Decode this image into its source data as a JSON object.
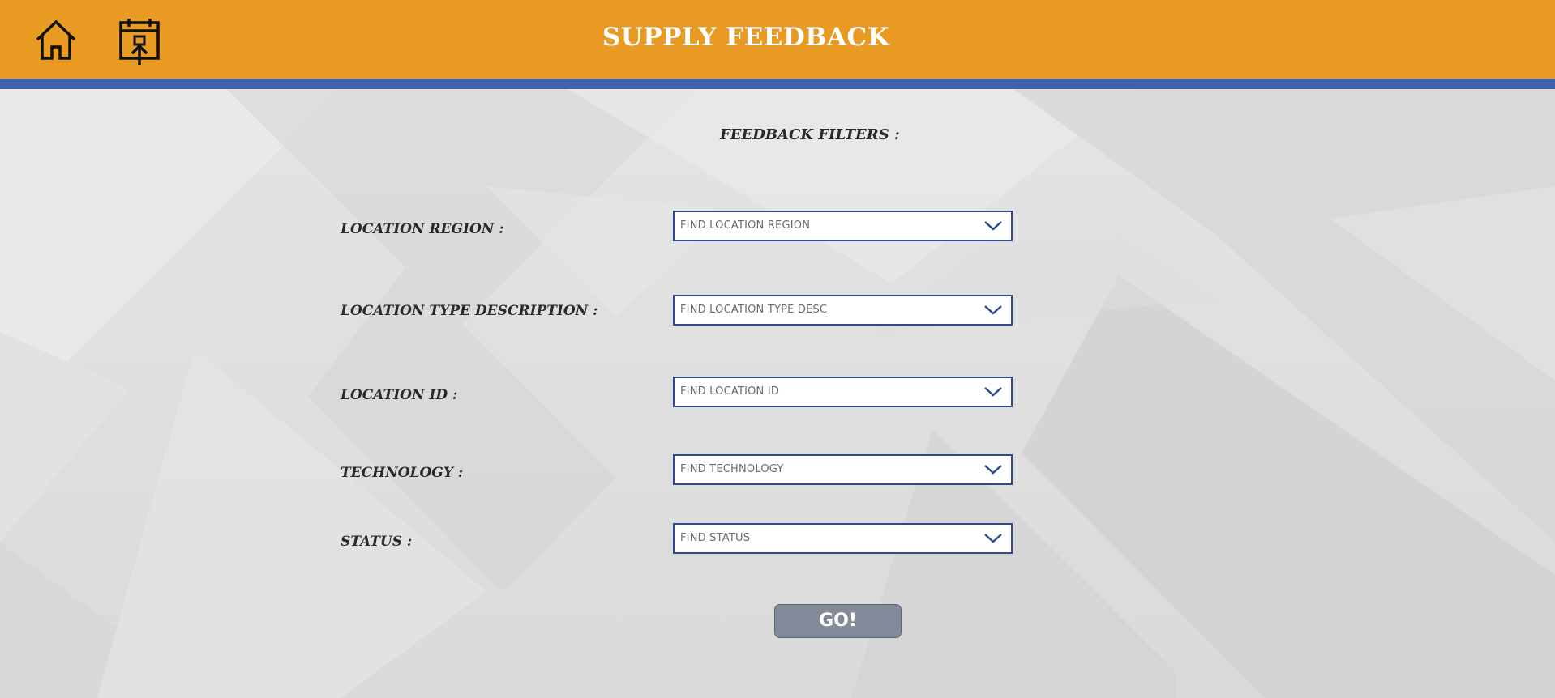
{
  "header": {
    "title": "SUPPLY FEEDBACK",
    "home_icon": "home-icon",
    "submit_icon": "calendar-upload-icon",
    "colors": {
      "bar": "#e89a22",
      "stripe": "#4160ad",
      "title": "#ffffff"
    }
  },
  "filters": {
    "title": "FEEDBACK FILTERS :",
    "fields": [
      {
        "label": "LOCATION REGION :",
        "placeholder": "FIND LOCATION REGION"
      },
      {
        "label": "LOCATION TYPE DESCRIPTION :",
        "placeholder": "FIND LOCATION TYPE DESC"
      },
      {
        "label": "LOCATION ID :",
        "placeholder": "FIND LOCATION ID"
      },
      {
        "label": "TECHNOLOGY :",
        "placeholder": "FIND TECHNOLOGY"
      },
      {
        "label": "STATUS :",
        "placeholder": "FIND STATUS"
      }
    ],
    "dropdown_icon": "chevron-down-icon",
    "border_color": "#2e4a8c"
  },
  "actions": {
    "go_label": "GO!",
    "go_color": "#838a99"
  }
}
